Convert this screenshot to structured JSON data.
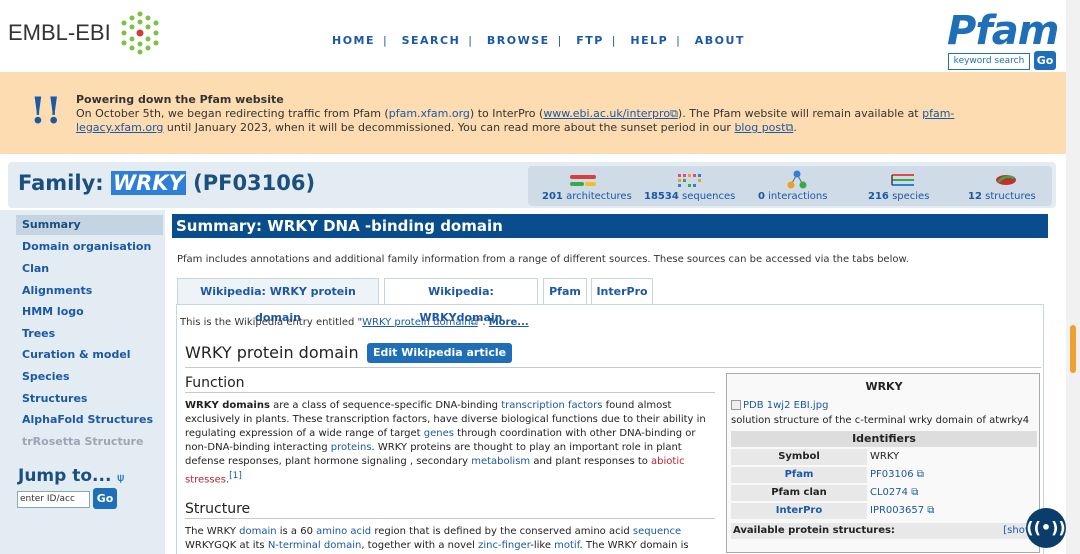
{
  "header": {
    "org_logo": "EMBL-EBI",
    "nav": [
      "HOME",
      "SEARCH",
      "BROWSE",
      "FTP",
      "HELP",
      "ABOUT"
    ],
    "pfam_logo": "Pfam",
    "keyword_search": "keyword search",
    "go": "Go"
  },
  "banner": {
    "icon": "!!",
    "title": "Powering down the Pfam website",
    "line1_a": "On October 5th, we began redirecting traffic from Pfam (",
    "link_pfam": "pfam.xfam.org",
    "line1_b": ") to InterPro (",
    "link_interpro": "www.ebi.ac.uk/interpro",
    "line1_c": "). The Pfam website will remain available at ",
    "link_legacy_a": "pfam-",
    "link_legacy_b": "legacy.xfam.org",
    "line2_a": " until January 2023, when it will be decommissioned. You can read more about the sunset period in our ",
    "link_blog": "blog post",
    "line2_b": "."
  },
  "family": {
    "prefix": "Family: ",
    "name": "WRKY",
    "accession": " (PF03106)",
    "stats": [
      {
        "count": "201",
        "label": "architectures"
      },
      {
        "count": "18534",
        "label": "sequences"
      },
      {
        "count": "0",
        "label": "interactions"
      },
      {
        "count": "216",
        "label": "species"
      },
      {
        "count": "12",
        "label": "structures"
      }
    ]
  },
  "sidebar": {
    "items": [
      {
        "label": "Summary"
      },
      {
        "label": "Domain organisation"
      },
      {
        "label": "Clan"
      },
      {
        "label": "Alignments"
      },
      {
        "label": "HMM logo"
      },
      {
        "label": "Trees"
      },
      {
        "label": "Curation & model"
      },
      {
        "label": "Species"
      },
      {
        "label": "Structures"
      },
      {
        "label": "AlphaFold Structures"
      },
      {
        "label": "trRosetta Structure"
      }
    ],
    "jump_title": "Jump to...",
    "jump_placeholder": "enter ID/acc",
    "go": "Go"
  },
  "main": {
    "summary_title": "Summary: WRKY DNA -binding domain",
    "intro": "Pfam includes annotations and additional family information from a range of different sources. These sources can be accessed via the tabs below.",
    "tabs": [
      "Wikipedia: WRKY protein domain",
      "Wikipedia: WRKYdomain",
      "Pfam",
      "InterPro"
    ],
    "wiki_intro_a": "This is the Wikipedia entry entitled \"",
    "wiki_intro_link": "WRKY protein domain",
    "wiki_intro_b": "\". ",
    "more": "More...",
    "article_title": "WRKY protein domain",
    "edit_button": "Edit Wikipedia article",
    "function_heading": "Function",
    "structure_heading": "Structure"
  },
  "infobox": {
    "title": "WRKY",
    "image": "PDB 1wj2 EBI.jpg",
    "caption": "solution structure of the c-terminal wrky domain of atwrky4",
    "identifiers": "Identifiers",
    "rows": [
      {
        "key": "Symbol",
        "value": "WRKY"
      },
      {
        "key": "Pfam",
        "value": "PF03106"
      },
      {
        "key": "Pfam clan",
        "value": "CL0274"
      },
      {
        "key": "InterPro",
        "value": "IPR003657"
      }
    ],
    "available": "Available protein structures:",
    "show": "[show"
  },
  "colors": {
    "accent": "#1e6fb8",
    "banner": "#fcdcb0",
    "summary_bar": "#0a4d8c"
  }
}
